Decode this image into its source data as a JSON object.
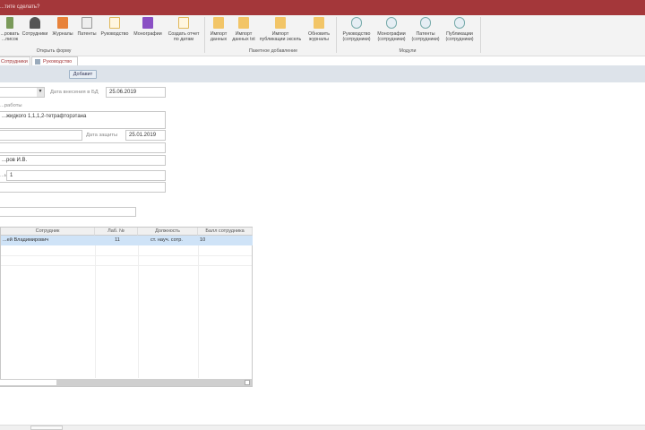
{
  "title_bar": {
    "search_hint": "...тите сделать?"
  },
  "ribbon": {
    "open_form_group": {
      "label": "Открыть форму",
      "buttons": [
        {
          "label": "...ровать\n...писок",
          "icon": "list-icon"
        },
        {
          "label": "Сотрудники",
          "icon": "person-icon"
        },
        {
          "label": "Журналы",
          "icon": "journal-icon"
        },
        {
          "label": "Патенты",
          "icon": "patent-icon"
        },
        {
          "label": "Руководство",
          "icon": "clipboard-icon"
        },
        {
          "label": "Монографии",
          "icon": "book-icon"
        },
        {
          "label": "Создать отчет\nпо датам",
          "icon": "report-icon"
        }
      ]
    },
    "batch_group": {
      "label": "Пакетное добавление",
      "buttons": [
        {
          "label": "Импорт\nданных",
          "icon": "folder-icon"
        },
        {
          "label": "Импорт\nданных txt",
          "icon": "folder-icon"
        },
        {
          "label": "Импорт\nпубликации эксель",
          "icon": "folder-icon"
        },
        {
          "label": "Обновить\nжурналы",
          "icon": "folder-icon"
        }
      ]
    },
    "modules_group": {
      "label": "Модули",
      "buttons": [
        {
          "label": "Руководство\n(сотрудники)",
          "icon": "module-icon"
        },
        {
          "label": "Монографии\n(сотрудники)",
          "icon": "module-icon"
        },
        {
          "label": "Патенты\n(сотрудники)",
          "icon": "module-icon"
        },
        {
          "label": "Публикации\n(сотрудники)",
          "icon": "module-icon"
        }
      ]
    }
  },
  "tabs": [
    {
      "label": "Сотрудники"
    },
    {
      "label": "Руководство",
      "active": true
    }
  ],
  "form": {
    "add_button": "Добавит",
    "date_added_label": "Дата внесения в БД",
    "date_added": "25.06.2019",
    "work_label": "...работы",
    "work_title": "...жидкого 1,1,1,2-тетрафторэтана",
    "defense_date_label": "Дата защиты",
    "defense_date": "25.01.2019",
    "supervisor": "...ров И.В.",
    "count_label": "...ы",
    "count": "1"
  },
  "grid": {
    "columns": [
      "Сотрудник",
      "Лаб. №",
      "Должность",
      "Балл сотрудника"
    ],
    "rows": [
      [
        "...ей Владимирович",
        "11",
        "ст. науч. сотр.",
        "10"
      ]
    ]
  },
  "colors": {
    "accent": "#a4373a",
    "header_band": "#dde3ea",
    "selected_row": "#cfe3f7"
  }
}
